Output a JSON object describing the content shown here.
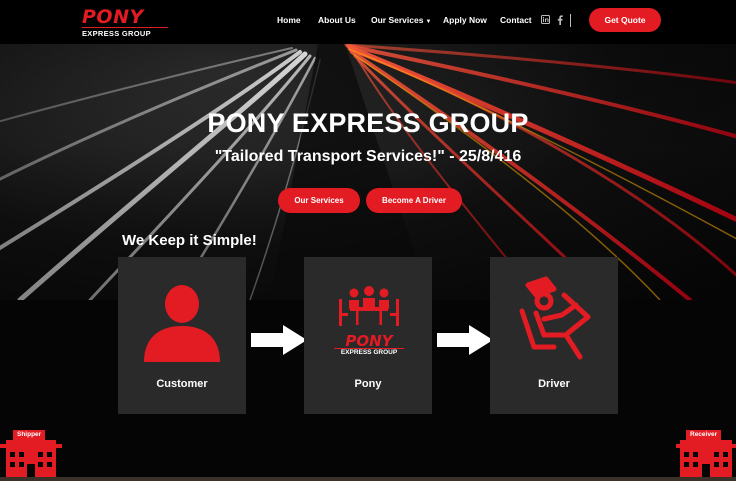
{
  "brand": {
    "logo_main": "PONY",
    "logo_sub": "EXPRESS GROUP"
  },
  "nav": {
    "items": [
      {
        "label": "Home"
      },
      {
        "label": "About Us"
      },
      {
        "label": "Our Services",
        "has_dropdown": true
      },
      {
        "label": "Apply Now"
      },
      {
        "label": "Contact"
      }
    ],
    "social": [
      "linkedin-icon",
      "facebook-icon"
    ],
    "cta_label": "Get Quote"
  },
  "hero": {
    "title": "PONY EXPRESS GROUP",
    "subtitle": "\"Tailored Transport Services!\" - 25/8/416",
    "buttons": [
      {
        "label": "Our Services"
      },
      {
        "label": "Become A Driver"
      }
    ]
  },
  "process": {
    "heading": "We Keep it Simple!",
    "steps": [
      {
        "label": "Customer",
        "icon": "user-icon"
      },
      {
        "label": "Pony",
        "icon": "meeting-icon"
      },
      {
        "label": "Driver",
        "icon": "driver-icon"
      }
    ]
  },
  "footer": {
    "left_building": "Shipper",
    "right_building": "Receiver"
  },
  "colors": {
    "accent": "#e31b23",
    "card": "#2a2a2a",
    "background": "#050505"
  }
}
